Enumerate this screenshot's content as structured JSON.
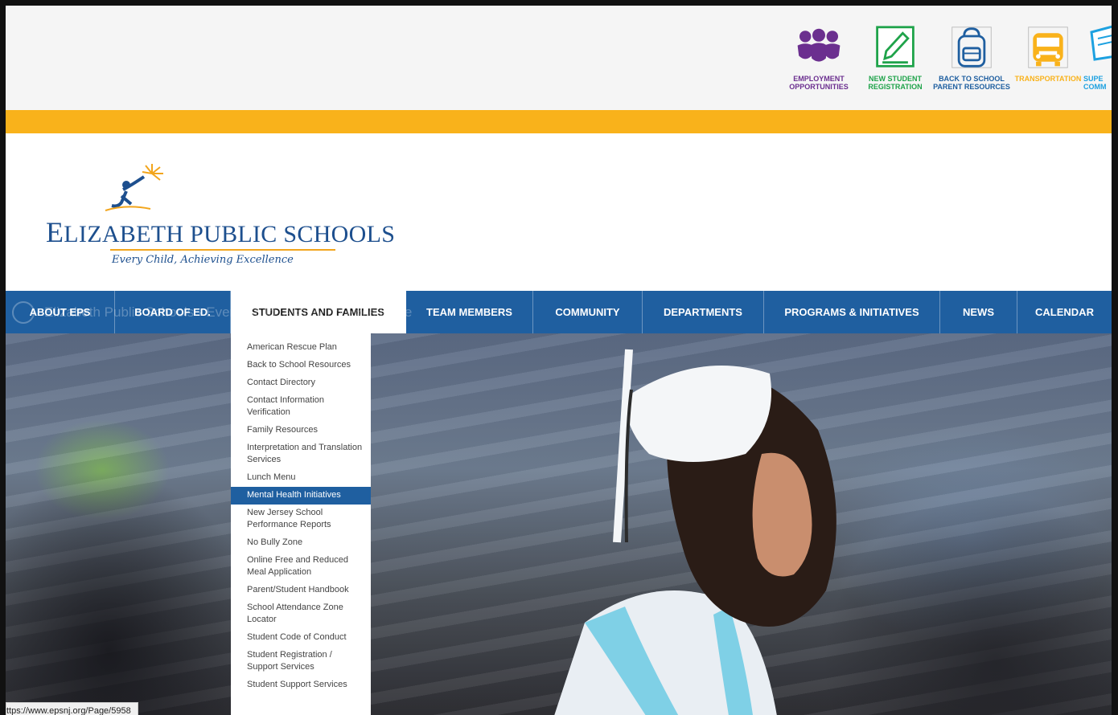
{
  "quick_links": [
    {
      "label": "EMPLOYMENT\nOPPORTUNITIES",
      "icon": "employment-people-icon",
      "color": "#6b2f8f"
    },
    {
      "label": "NEW STUDENT\nREGISTRATION",
      "icon": "registration-pencil-icon",
      "color": "#1fa34a"
    },
    {
      "label": "BACK TO SCHOOL\nPARENT RESOURCES",
      "icon": "backpack-icon",
      "color": "#1f5fa0"
    },
    {
      "label": "TRANSPORTATION",
      "icon": "school-bus-icon",
      "color": "#f9b21b"
    },
    {
      "label": "SUPE\nCOMM",
      "icon": "superintendent-communication-icon",
      "color": "#1da1e0"
    }
  ],
  "logo": {
    "title_first": "E",
    "title_rest": "LIZABETH PUBLIC SCHOOLS",
    "tagline": "Every Child, Achieving Excellence"
  },
  "nav": {
    "ghost_text": "Elizabeth Public Schools · Every Child, Achieving Excellence",
    "items": [
      {
        "label": "ABOUT EPS"
      },
      {
        "label": "BOARD OF ED."
      },
      {
        "label": "STUDENTS AND FAMILIES"
      },
      {
        "label": "TEAM MEMBERS"
      },
      {
        "label": "COMMUNITY"
      },
      {
        "label": "DEPARTMENTS"
      },
      {
        "label": "PROGRAMS & INITIATIVES"
      },
      {
        "label": "NEWS"
      },
      {
        "label": "CALENDAR"
      }
    ],
    "active": "STUDENTS AND FAMILIES"
  },
  "dropdown": {
    "items": [
      "American Rescue Plan",
      "Back to School Resources",
      "Contact Directory",
      "Contact Information Verification",
      "Family Resources",
      "Interpretation and Translation Services",
      "Lunch Menu",
      "Mental Health Initiatives",
      "New Jersey School Performance Reports",
      "No Bully Zone",
      "Online Free and Reduced Meal Application",
      "Parent/Student Handbook",
      "School Attendance Zone Locator",
      "Student Code of Conduct",
      "Student Registration / Support Services",
      "Student Support Services"
    ],
    "selected": "Mental Health Initiatives"
  },
  "status_url": "ttps://www.epsnj.org/Page/5958",
  "colors": {
    "nav_blue": "#1f5fa0",
    "gold": "#f9b21b",
    "logo_blue": "#1d4f8e"
  }
}
